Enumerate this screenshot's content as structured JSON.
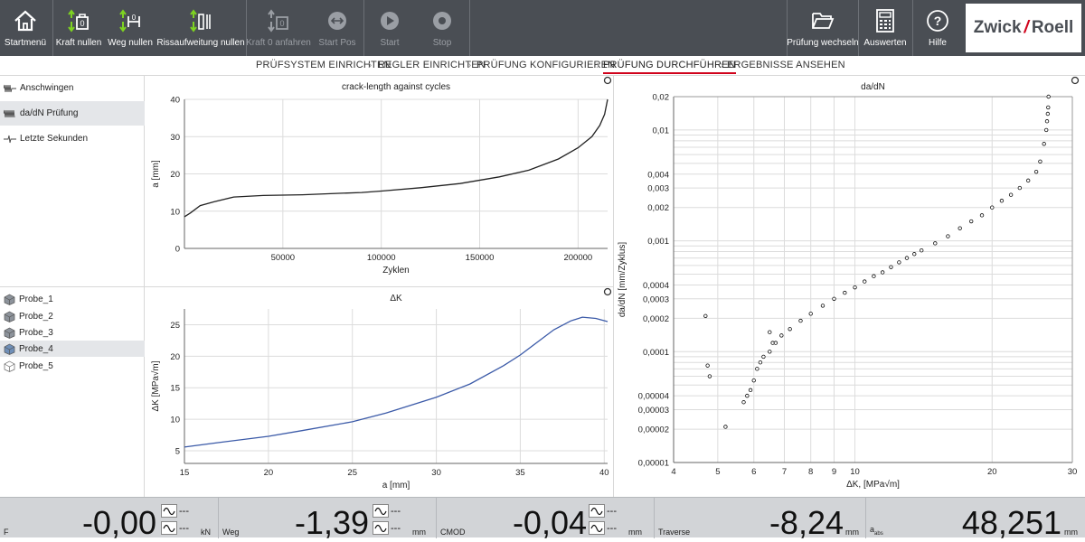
{
  "toolbar": {
    "buttons": [
      {
        "label": "Startmenü",
        "icon": "home-icon",
        "enabled": true
      },
      {
        "label": "Kraft nullen",
        "icon": "force-zero-icon",
        "enabled": true
      },
      {
        "label": "Weg nullen",
        "icon": "travel-zero-icon",
        "enabled": true
      },
      {
        "label": "Rissaufweitung nullen",
        "icon": "crack-opening-zero-icon",
        "enabled": true
      },
      {
        "label": "Kraft 0 anfahren",
        "icon": "force-zero-approach-icon",
        "enabled": false
      },
      {
        "label": "Start Pos",
        "icon": "start-position-icon",
        "enabled": false
      },
      {
        "label": "Start",
        "icon": "play-icon",
        "enabled": false
      },
      {
        "label": "Stop",
        "icon": "stop-icon",
        "enabled": false
      },
      {
        "label": "Prüfung wechseln",
        "icon": "folder-icon",
        "enabled": true
      },
      {
        "label": "Auswerten",
        "icon": "calculator-icon",
        "enabled": true
      },
      {
        "label": "Hilfe",
        "icon": "help-icon",
        "enabled": true
      }
    ],
    "logo_text": {
      "left": "Zwick",
      "right": "Roell"
    }
  },
  "workflow": {
    "steps": [
      "PRÜFSYSTEM EINRICHTEN",
      "REGLER EINRICHTEN",
      "PRÜFUNG KONFIGURIEREN",
      "PRÜFUNG DURCHFÜHREN",
      "ERGEBNISSE ANSEHEN"
    ],
    "active": "PRÜFUNG DURCHFÜHREN"
  },
  "sidebar": {
    "views": [
      {
        "label": "Anschwingen",
        "selected": false
      },
      {
        "label": "da/dN Prüfung",
        "selected": true
      },
      {
        "label": "Letzte Sekunden",
        "selected": false
      }
    ],
    "specimens": [
      {
        "label": "Probe_1",
        "selected": false,
        "filled": true
      },
      {
        "label": "Probe_2",
        "selected": false,
        "filled": true
      },
      {
        "label": "Probe_3",
        "selected": false,
        "filled": true
      },
      {
        "label": "Probe_4",
        "selected": true,
        "filled": true
      },
      {
        "label": "Probe_5",
        "selected": false,
        "filled": false
      }
    ]
  },
  "chart_data": [
    {
      "type": "line",
      "title": "crack-length against cycles",
      "xlabel": "Zyklen",
      "ylabel": "a [mm]",
      "xlim": [
        0,
        215000
      ],
      "ylim": [
        0,
        40
      ],
      "xticks": [
        50000,
        100000,
        150000,
        200000
      ],
      "yticks": [
        0,
        10,
        20,
        30,
        40
      ],
      "grid": true,
      "color": "#222222",
      "series": [
        {
          "x": [
            0,
            3000,
            8000,
            15000,
            25000,
            40000,
            60000,
            80000,
            90000,
            100000,
            120000,
            140000,
            160000,
            175000,
            190000,
            200000,
            207000,
            211000,
            213500,
            215000
          ],
          "y": [
            8.5,
            9.5,
            11.5,
            12.5,
            13.8,
            14.2,
            14.4,
            14.8,
            15.0,
            15.4,
            16.3,
            17.4,
            19.2,
            21.0,
            24.0,
            27.0,
            30.0,
            33.0,
            36.0,
            40.0
          ]
        }
      ]
    },
    {
      "type": "line",
      "title": "ΔK",
      "xlabel": "a [mm]",
      "ylabel": "ΔK [MPa√m]",
      "xlim": [
        15,
        40.2
      ],
      "ylim": [
        3,
        27.5
      ],
      "xticks": [
        15,
        20,
        25,
        30,
        35,
        40
      ],
      "yticks": [
        5,
        10,
        15,
        20,
        25
      ],
      "grid": true,
      "color": "#3b5aa8",
      "series": [
        {
          "x": [
            15,
            17,
            20,
            22,
            25,
            27,
            30,
            32,
            34,
            35,
            36,
            37,
            38,
            38.7,
            39.5,
            40.2
          ],
          "y": [
            5.6,
            6.3,
            7.3,
            8.2,
            9.6,
            11.0,
            13.5,
            15.6,
            18.5,
            20.2,
            22.2,
            24.2,
            25.6,
            26.2,
            26.0,
            25.5
          ]
        }
      ]
    },
    {
      "type": "scatter",
      "title": "da/dN",
      "xlabel": "ΔK, [MPa√m]",
      "ylabel": "da/dN [mm/Zyklus]",
      "xscale": "log",
      "yscale": "log",
      "xlim": [
        4,
        30
      ],
      "ylim": [
        1e-05,
        0.02
      ],
      "xticks": [
        4,
        5,
        6,
        7,
        8,
        9,
        10,
        20,
        30
      ],
      "yticks": [
        1e-05,
        2e-05,
        3e-05,
        4e-05,
        0.0001,
        0.0002,
        0.0003,
        0.0004,
        0.001,
        0.002,
        0.003,
        0.004,
        0.01,
        0.02
      ],
      "ytick_labels": [
        "0,00001",
        "0,00002",
        "0,00003",
        "0,00004",
        "0,0001",
        "0,0002",
        "0,0003",
        "0,0004",
        "0,001",
        "0,002",
        "0,003",
        "0,004",
        "0,01",
        "0,02"
      ],
      "grid": true,
      "marker": "open-circle",
      "series": [
        {
          "x": [
            4.7,
            4.75,
            4.8,
            5.2,
            5.7,
            5.8,
            5.9,
            6.0,
            6.1,
            6.2,
            6.3,
            6.5,
            6.6,
            6.5,
            6.7,
            6.9,
            7.2,
            7.6,
            8.0,
            8.5,
            9.0,
            9.5,
            10.0,
            10.5,
            11.0,
            11.5,
            12.0,
            12.5,
            13.0,
            13.5,
            14.0,
            15.0,
            16.0,
            17.0,
            18.0,
            19.0,
            20.0,
            21.0,
            22.0,
            23.0,
            24.0,
            25.0,
            25.5,
            26.0,
            26.3,
            26.4,
            26.5,
            26.55,
            26.6
          ],
          "y": [
            0.00021,
            7.5e-05,
            6e-05,
            2.1e-05,
            3.5e-05,
            4e-05,
            4.5e-05,
            5.5e-05,
            7e-05,
            8e-05,
            9e-05,
            0.0001,
            0.00012,
            0.00015,
            0.00012,
            0.00014,
            0.00016,
            0.00019,
            0.00022,
            0.00026,
            0.0003,
            0.00034,
            0.00038,
            0.00043,
            0.00048,
            0.00052,
            0.00058,
            0.00064,
            0.0007,
            0.00076,
            0.00082,
            0.00095,
            0.0011,
            0.0013,
            0.0015,
            0.0017,
            0.002,
            0.0023,
            0.0026,
            0.003,
            0.0035,
            0.0042,
            0.0052,
            0.0075,
            0.01,
            0.012,
            0.014,
            0.016,
            0.02
          ]
        }
      ]
    }
  ],
  "measurements": [
    {
      "label": "F",
      "value": "-0,00",
      "unit": "kN"
    },
    {
      "label": "Weg",
      "value": "-1,39",
      "unit": "mm"
    },
    {
      "label": "CMOD",
      "value": "-0,04",
      "unit": "mm"
    },
    {
      "label": "Traverse",
      "value": "-8,24",
      "unit": "mm"
    },
    {
      "label": "a",
      "label_sub": "abs",
      "value": "48,251",
      "unit": "mm"
    }
  ],
  "indicator_dash": "---"
}
